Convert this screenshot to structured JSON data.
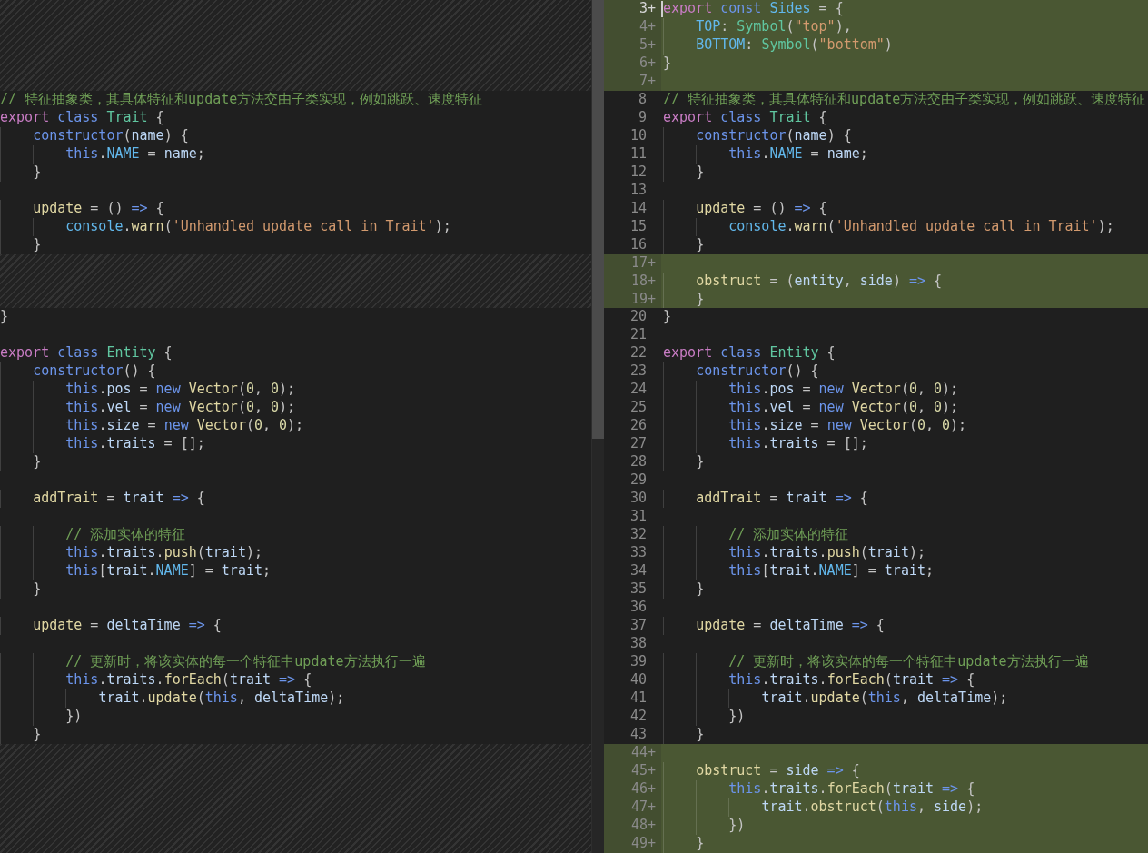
{
  "original_pane": {
    "lines": [
      {
        "kind": "filler"
      },
      {
        "kind": "filler"
      },
      {
        "kind": "filler"
      },
      {
        "kind": "filler"
      },
      {
        "kind": "filler"
      },
      {
        "kind": "code",
        "segments": [
          {
            "kind": "comment",
            "text": "// 特征抽象类，其具体特征和update方法交由子类实现，例如跳跃、速度特征"
          }
        ]
      },
      {
        "kind": "code",
        "segments": [
          {
            "kind": "keyword",
            "text": "export "
          },
          {
            "kind": "storage",
            "text": "class "
          },
          {
            "kind": "type",
            "text": "Trait"
          },
          {
            "kind": "plain",
            "text": " {"
          }
        ]
      },
      {
        "kind": "code",
        "segments": [
          {
            "kind": "storage",
            "text": "    constructor"
          },
          {
            "kind": "plain",
            "text": "("
          },
          {
            "kind": "variable",
            "text": "name"
          },
          {
            "kind": "plain",
            "text": ") {"
          }
        ]
      },
      {
        "kind": "code",
        "segments": [
          {
            "kind": "storage",
            "text": "        this"
          },
          {
            "kind": "plain",
            "text": "."
          },
          {
            "kind": "constant",
            "text": "NAME"
          },
          {
            "kind": "plain",
            "text": " = "
          },
          {
            "kind": "variable",
            "text": "name"
          },
          {
            "kind": "plain",
            "text": ";"
          }
        ]
      },
      {
        "kind": "code",
        "segments": [
          {
            "kind": "plain",
            "text": "    }"
          }
        ]
      },
      {
        "kind": "code"
      },
      {
        "kind": "code",
        "segments": [
          {
            "kind": "method",
            "text": "    update"
          },
          {
            "kind": "plain",
            "text": " = () "
          },
          {
            "kind": "storage",
            "text": "=>"
          },
          {
            "kind": "plain",
            "text": " {"
          }
        ]
      },
      {
        "kind": "code",
        "segments": [
          {
            "kind": "constant",
            "text": "        console"
          },
          {
            "kind": "plain",
            "text": "."
          },
          {
            "kind": "method",
            "text": "warn"
          },
          {
            "kind": "plain",
            "text": "("
          },
          {
            "kind": "string",
            "text": "'Unhandled update call in Trait'"
          },
          {
            "kind": "plain",
            "text": ");"
          }
        ]
      },
      {
        "kind": "code",
        "segments": [
          {
            "kind": "plain",
            "text": "    }"
          }
        ]
      },
      {
        "kind": "filler"
      },
      {
        "kind": "filler"
      },
      {
        "kind": "filler"
      },
      {
        "kind": "code",
        "segments": [
          {
            "kind": "plain",
            "text": "}"
          }
        ]
      },
      {
        "kind": "code"
      },
      {
        "kind": "code",
        "segments": [
          {
            "kind": "keyword",
            "text": "export "
          },
          {
            "kind": "storage",
            "text": "class "
          },
          {
            "kind": "type",
            "text": "Entity"
          },
          {
            "kind": "plain",
            "text": " {"
          }
        ]
      },
      {
        "kind": "code",
        "segments": [
          {
            "kind": "storage",
            "text": "    constructor"
          },
          {
            "kind": "plain",
            "text": "() {"
          }
        ]
      },
      {
        "kind": "code",
        "segments": [
          {
            "kind": "storage",
            "text": "        this"
          },
          {
            "kind": "plain",
            "text": "."
          },
          {
            "kind": "variable",
            "text": "pos"
          },
          {
            "kind": "plain",
            "text": " = "
          },
          {
            "kind": "storage",
            "text": "new "
          },
          {
            "kind": "method",
            "text": "Vector"
          },
          {
            "kind": "plain",
            "text": "("
          },
          {
            "kind": "number",
            "text": "0"
          },
          {
            "kind": "plain",
            "text": ", "
          },
          {
            "kind": "number",
            "text": "0"
          },
          {
            "kind": "plain",
            "text": ");"
          }
        ]
      },
      {
        "kind": "code",
        "segments": [
          {
            "kind": "storage",
            "text": "        this"
          },
          {
            "kind": "plain",
            "text": "."
          },
          {
            "kind": "variable",
            "text": "vel"
          },
          {
            "kind": "plain",
            "text": " = "
          },
          {
            "kind": "storage",
            "text": "new "
          },
          {
            "kind": "method",
            "text": "Vector"
          },
          {
            "kind": "plain",
            "text": "("
          },
          {
            "kind": "number",
            "text": "0"
          },
          {
            "kind": "plain",
            "text": ", "
          },
          {
            "kind": "number",
            "text": "0"
          },
          {
            "kind": "plain",
            "text": ");"
          }
        ]
      },
      {
        "kind": "code",
        "segments": [
          {
            "kind": "storage",
            "text": "        this"
          },
          {
            "kind": "plain",
            "text": "."
          },
          {
            "kind": "variable",
            "text": "size"
          },
          {
            "kind": "plain",
            "text": " = "
          },
          {
            "kind": "storage",
            "text": "new "
          },
          {
            "kind": "method",
            "text": "Vector"
          },
          {
            "kind": "plain",
            "text": "("
          },
          {
            "kind": "number",
            "text": "0"
          },
          {
            "kind": "plain",
            "text": ", "
          },
          {
            "kind": "number",
            "text": "0"
          },
          {
            "kind": "plain",
            "text": ");"
          }
        ]
      },
      {
        "kind": "code",
        "segments": [
          {
            "kind": "storage",
            "text": "        this"
          },
          {
            "kind": "plain",
            "text": "."
          },
          {
            "kind": "variable",
            "text": "traits"
          },
          {
            "kind": "plain",
            "text": " = [];"
          }
        ]
      },
      {
        "kind": "code",
        "segments": [
          {
            "kind": "plain",
            "text": "    }"
          }
        ]
      },
      {
        "kind": "code"
      },
      {
        "kind": "code",
        "segments": [
          {
            "kind": "method",
            "text": "    addTrait"
          },
          {
            "kind": "plain",
            "text": " = "
          },
          {
            "kind": "variable",
            "text": "trait"
          },
          {
            "kind": "storage",
            "text": " =>"
          },
          {
            "kind": "plain",
            "text": " {"
          }
        ]
      },
      {
        "kind": "code"
      },
      {
        "kind": "code",
        "segments": [
          {
            "kind": "comment",
            "text": "        // 添加实体的特征"
          }
        ]
      },
      {
        "kind": "code",
        "segments": [
          {
            "kind": "storage",
            "text": "        this"
          },
          {
            "kind": "plain",
            "text": "."
          },
          {
            "kind": "variable",
            "text": "traits"
          },
          {
            "kind": "plain",
            "text": "."
          },
          {
            "kind": "method",
            "text": "push"
          },
          {
            "kind": "plain",
            "text": "("
          },
          {
            "kind": "variable",
            "text": "trait"
          },
          {
            "kind": "plain",
            "text": ");"
          }
        ]
      },
      {
        "kind": "code",
        "segments": [
          {
            "kind": "storage",
            "text": "        this"
          },
          {
            "kind": "plain",
            "text": "["
          },
          {
            "kind": "variable",
            "text": "trait"
          },
          {
            "kind": "plain",
            "text": "."
          },
          {
            "kind": "constant",
            "text": "NAME"
          },
          {
            "kind": "plain",
            "text": "] = "
          },
          {
            "kind": "variable",
            "text": "trait"
          },
          {
            "kind": "plain",
            "text": ";"
          }
        ]
      },
      {
        "kind": "code",
        "segments": [
          {
            "kind": "plain",
            "text": "    }"
          }
        ]
      },
      {
        "kind": "code"
      },
      {
        "kind": "code",
        "segments": [
          {
            "kind": "method",
            "text": "    update"
          },
          {
            "kind": "plain",
            "text": " = "
          },
          {
            "kind": "variable",
            "text": "deltaTime"
          },
          {
            "kind": "storage",
            "text": " =>"
          },
          {
            "kind": "plain",
            "text": " {"
          }
        ]
      },
      {
        "kind": "code"
      },
      {
        "kind": "code",
        "segments": [
          {
            "kind": "comment",
            "text": "        // 更新时，将该实体的每一个特征中update方法执行一遍"
          }
        ]
      },
      {
        "kind": "code",
        "segments": [
          {
            "kind": "storage",
            "text": "        this"
          },
          {
            "kind": "plain",
            "text": "."
          },
          {
            "kind": "variable",
            "text": "traits"
          },
          {
            "kind": "plain",
            "text": "."
          },
          {
            "kind": "method",
            "text": "forEach"
          },
          {
            "kind": "plain",
            "text": "("
          },
          {
            "kind": "variable",
            "text": "trait"
          },
          {
            "kind": "storage",
            "text": " =>"
          },
          {
            "kind": "plain",
            "text": " {"
          }
        ]
      },
      {
        "kind": "code",
        "segments": [
          {
            "kind": "variable",
            "text": "            trait"
          },
          {
            "kind": "plain",
            "text": "."
          },
          {
            "kind": "method",
            "text": "update"
          },
          {
            "kind": "plain",
            "text": "("
          },
          {
            "kind": "storage",
            "text": "this"
          },
          {
            "kind": "plain",
            "text": ", "
          },
          {
            "kind": "variable",
            "text": "deltaTime"
          },
          {
            "kind": "plain",
            "text": ");"
          }
        ]
      },
      {
        "kind": "code",
        "segments": [
          {
            "kind": "plain",
            "text": "        })"
          }
        ]
      },
      {
        "kind": "code",
        "segments": [
          {
            "kind": "plain",
            "text": "    }"
          }
        ]
      },
      {
        "kind": "filler"
      },
      {
        "kind": "filler"
      },
      {
        "kind": "filler"
      },
      {
        "kind": "filler"
      },
      {
        "kind": "filler"
      },
      {
        "kind": "filler"
      }
    ]
  },
  "modified_pane": {
    "lines": [
      {
        "number": "3+",
        "added": true,
        "cursor": true,
        "segments": [
          {
            "kind": "keyword",
            "text": "export "
          },
          {
            "kind": "storage",
            "text": "const "
          },
          {
            "kind": "constant",
            "text": "Sides"
          },
          {
            "kind": "plain",
            "text": " = {"
          }
        ]
      },
      {
        "number": "4+",
        "added": true,
        "cursor": false,
        "segments": [
          {
            "kind": "constant",
            "text": "    TOP"
          },
          {
            "kind": "plain",
            "text": ": "
          },
          {
            "kind": "type",
            "text": "Symbol"
          },
          {
            "kind": "plain",
            "text": "("
          },
          {
            "kind": "string",
            "text": "\"top\""
          },
          {
            "kind": "plain",
            "text": "),"
          }
        ]
      },
      {
        "number": "5+",
        "added": true,
        "cursor": false,
        "segments": [
          {
            "kind": "constant",
            "text": "    BOTTOM"
          },
          {
            "kind": "plain",
            "text": ": "
          },
          {
            "kind": "type",
            "text": "Symbol"
          },
          {
            "kind": "plain",
            "text": "("
          },
          {
            "kind": "string",
            "text": "\"bottom\""
          },
          {
            "kind": "plain",
            "text": ")"
          }
        ]
      },
      {
        "number": "6+",
        "added": true,
        "cursor": false,
        "segments": [
          {
            "kind": "plain",
            "text": "}"
          }
        ]
      },
      {
        "number": "7+",
        "added": true,
        "cursor": false
      },
      {
        "number": "8",
        "added": false,
        "cursor": false,
        "segments": [
          {
            "kind": "comment",
            "text": "// 特征抽象类，其具体特征和update方法交由子类实现，例如跳跃、速度特征"
          }
        ]
      },
      {
        "number": "9",
        "added": false,
        "cursor": false,
        "segments": [
          {
            "kind": "keyword",
            "text": "export "
          },
          {
            "kind": "storage",
            "text": "class "
          },
          {
            "kind": "type",
            "text": "Trait"
          },
          {
            "kind": "plain",
            "text": " {"
          }
        ]
      },
      {
        "number": "10",
        "added": false,
        "cursor": false,
        "segments": [
          {
            "kind": "storage",
            "text": "    constructor"
          },
          {
            "kind": "plain",
            "text": "("
          },
          {
            "kind": "variable",
            "text": "name"
          },
          {
            "kind": "plain",
            "text": ") {"
          }
        ]
      },
      {
        "number": "11",
        "added": false,
        "cursor": false,
        "segments": [
          {
            "kind": "storage",
            "text": "        this"
          },
          {
            "kind": "plain",
            "text": "."
          },
          {
            "kind": "constant",
            "text": "NAME"
          },
          {
            "kind": "plain",
            "text": " = "
          },
          {
            "kind": "variable",
            "text": "name"
          },
          {
            "kind": "plain",
            "text": ";"
          }
        ]
      },
      {
        "number": "12",
        "added": false,
        "cursor": false,
        "segments": [
          {
            "kind": "plain",
            "text": "    }"
          }
        ]
      },
      {
        "number": "13",
        "added": false,
        "cursor": false
      },
      {
        "number": "14",
        "added": false,
        "cursor": false,
        "segments": [
          {
            "kind": "method",
            "text": "    update"
          },
          {
            "kind": "plain",
            "text": " = () "
          },
          {
            "kind": "storage",
            "text": "=>"
          },
          {
            "kind": "plain",
            "text": " {"
          }
        ]
      },
      {
        "number": "15",
        "added": false,
        "cursor": false,
        "segments": [
          {
            "kind": "constant",
            "text": "        console"
          },
          {
            "kind": "plain",
            "text": "."
          },
          {
            "kind": "method",
            "text": "warn"
          },
          {
            "kind": "plain",
            "text": "("
          },
          {
            "kind": "string",
            "text": "'Unhandled update call in Trait'"
          },
          {
            "kind": "plain",
            "text": ");"
          }
        ]
      },
      {
        "number": "16",
        "added": false,
        "cursor": false,
        "segments": [
          {
            "kind": "plain",
            "text": "    }"
          }
        ]
      },
      {
        "number": "17+",
        "added": true,
        "cursor": false
      },
      {
        "number": "18+",
        "added": true,
        "cursor": false,
        "segments": [
          {
            "kind": "method",
            "text": "    obstruct"
          },
          {
            "kind": "plain",
            "text": " = ("
          },
          {
            "kind": "variable",
            "text": "entity"
          },
          {
            "kind": "plain",
            "text": ", "
          },
          {
            "kind": "variable",
            "text": "side"
          },
          {
            "kind": "plain",
            "text": ") "
          },
          {
            "kind": "storage",
            "text": "=>"
          },
          {
            "kind": "plain",
            "text": " {"
          }
        ]
      },
      {
        "number": "19+",
        "added": true,
        "cursor": false,
        "segments": [
          {
            "kind": "plain",
            "text": "    }"
          }
        ]
      },
      {
        "number": "20",
        "added": false,
        "cursor": false,
        "segments": [
          {
            "kind": "plain",
            "text": "}"
          }
        ]
      },
      {
        "number": "21",
        "added": false,
        "cursor": false
      },
      {
        "number": "22",
        "added": false,
        "cursor": false,
        "segments": [
          {
            "kind": "keyword",
            "text": "export "
          },
          {
            "kind": "storage",
            "text": "class "
          },
          {
            "kind": "type",
            "text": "Entity"
          },
          {
            "kind": "plain",
            "text": " {"
          }
        ]
      },
      {
        "number": "23",
        "added": false,
        "cursor": false,
        "segments": [
          {
            "kind": "storage",
            "text": "    constructor"
          },
          {
            "kind": "plain",
            "text": "() {"
          }
        ]
      },
      {
        "number": "24",
        "added": false,
        "cursor": false,
        "segments": [
          {
            "kind": "storage",
            "text": "        this"
          },
          {
            "kind": "plain",
            "text": "."
          },
          {
            "kind": "variable",
            "text": "pos"
          },
          {
            "kind": "plain",
            "text": " = "
          },
          {
            "kind": "storage",
            "text": "new "
          },
          {
            "kind": "method",
            "text": "Vector"
          },
          {
            "kind": "plain",
            "text": "("
          },
          {
            "kind": "number",
            "text": "0"
          },
          {
            "kind": "plain",
            "text": ", "
          },
          {
            "kind": "number",
            "text": "0"
          },
          {
            "kind": "plain",
            "text": ");"
          }
        ]
      },
      {
        "number": "25",
        "added": false,
        "cursor": false,
        "segments": [
          {
            "kind": "storage",
            "text": "        this"
          },
          {
            "kind": "plain",
            "text": "."
          },
          {
            "kind": "variable",
            "text": "vel"
          },
          {
            "kind": "plain",
            "text": " = "
          },
          {
            "kind": "storage",
            "text": "new "
          },
          {
            "kind": "method",
            "text": "Vector"
          },
          {
            "kind": "plain",
            "text": "("
          },
          {
            "kind": "number",
            "text": "0"
          },
          {
            "kind": "plain",
            "text": ", "
          },
          {
            "kind": "number",
            "text": "0"
          },
          {
            "kind": "plain",
            "text": ");"
          }
        ]
      },
      {
        "number": "26",
        "added": false,
        "cursor": false,
        "segments": [
          {
            "kind": "storage",
            "text": "        this"
          },
          {
            "kind": "plain",
            "text": "."
          },
          {
            "kind": "variable",
            "text": "size"
          },
          {
            "kind": "plain",
            "text": " = "
          },
          {
            "kind": "storage",
            "text": "new "
          },
          {
            "kind": "method",
            "text": "Vector"
          },
          {
            "kind": "plain",
            "text": "("
          },
          {
            "kind": "number",
            "text": "0"
          },
          {
            "kind": "plain",
            "text": ", "
          },
          {
            "kind": "number",
            "text": "0"
          },
          {
            "kind": "plain",
            "text": ");"
          }
        ]
      },
      {
        "number": "27",
        "added": false,
        "cursor": false,
        "segments": [
          {
            "kind": "storage",
            "text": "        this"
          },
          {
            "kind": "plain",
            "text": "."
          },
          {
            "kind": "variable",
            "text": "traits"
          },
          {
            "kind": "plain",
            "text": " = [];"
          }
        ]
      },
      {
        "number": "28",
        "added": false,
        "cursor": false,
        "segments": [
          {
            "kind": "plain",
            "text": "    }"
          }
        ]
      },
      {
        "number": "29",
        "added": false,
        "cursor": false
      },
      {
        "number": "30",
        "added": false,
        "cursor": false,
        "segments": [
          {
            "kind": "method",
            "text": "    addTrait"
          },
          {
            "kind": "plain",
            "text": " = "
          },
          {
            "kind": "variable",
            "text": "trait"
          },
          {
            "kind": "storage",
            "text": " =>"
          },
          {
            "kind": "plain",
            "text": " {"
          }
        ]
      },
      {
        "number": "31",
        "added": false,
        "cursor": false
      },
      {
        "number": "32",
        "added": false,
        "cursor": false,
        "segments": [
          {
            "kind": "comment",
            "text": "        // 添加实体的特征"
          }
        ]
      },
      {
        "number": "33",
        "added": false,
        "cursor": false,
        "segments": [
          {
            "kind": "storage",
            "text": "        this"
          },
          {
            "kind": "plain",
            "text": "."
          },
          {
            "kind": "variable",
            "text": "traits"
          },
          {
            "kind": "plain",
            "text": "."
          },
          {
            "kind": "method",
            "text": "push"
          },
          {
            "kind": "plain",
            "text": "("
          },
          {
            "kind": "variable",
            "text": "trait"
          },
          {
            "kind": "plain",
            "text": ");"
          }
        ]
      },
      {
        "number": "34",
        "added": false,
        "cursor": false,
        "segments": [
          {
            "kind": "storage",
            "text": "        this"
          },
          {
            "kind": "plain",
            "text": "["
          },
          {
            "kind": "variable",
            "text": "trait"
          },
          {
            "kind": "plain",
            "text": "."
          },
          {
            "kind": "constant",
            "text": "NAME"
          },
          {
            "kind": "plain",
            "text": "] = "
          },
          {
            "kind": "variable",
            "text": "trait"
          },
          {
            "kind": "plain",
            "text": ";"
          }
        ]
      },
      {
        "number": "35",
        "added": false,
        "cursor": false,
        "segments": [
          {
            "kind": "plain",
            "text": "    }"
          }
        ]
      },
      {
        "number": "36",
        "added": false,
        "cursor": false
      },
      {
        "number": "37",
        "added": false,
        "cursor": false,
        "segments": [
          {
            "kind": "method",
            "text": "    update"
          },
          {
            "kind": "plain",
            "text": " = "
          },
          {
            "kind": "variable",
            "text": "deltaTime"
          },
          {
            "kind": "storage",
            "text": " =>"
          },
          {
            "kind": "plain",
            "text": " {"
          }
        ]
      },
      {
        "number": "38",
        "added": false,
        "cursor": false
      },
      {
        "number": "39",
        "added": false,
        "cursor": false,
        "segments": [
          {
            "kind": "comment",
            "text": "        // 更新时，将该实体的每一个特征中update方法执行一遍"
          }
        ]
      },
      {
        "number": "40",
        "added": false,
        "cursor": false,
        "segments": [
          {
            "kind": "storage",
            "text": "        this"
          },
          {
            "kind": "plain",
            "text": "."
          },
          {
            "kind": "variable",
            "text": "traits"
          },
          {
            "kind": "plain",
            "text": "."
          },
          {
            "kind": "method",
            "text": "forEach"
          },
          {
            "kind": "plain",
            "text": "("
          },
          {
            "kind": "variable",
            "text": "trait"
          },
          {
            "kind": "storage",
            "text": " =>"
          },
          {
            "kind": "plain",
            "text": " {"
          }
        ]
      },
      {
        "number": "41",
        "added": false,
        "cursor": false,
        "segments": [
          {
            "kind": "variable",
            "text": "            trait"
          },
          {
            "kind": "plain",
            "text": "."
          },
          {
            "kind": "method",
            "text": "update"
          },
          {
            "kind": "plain",
            "text": "("
          },
          {
            "kind": "storage",
            "text": "this"
          },
          {
            "kind": "plain",
            "text": ", "
          },
          {
            "kind": "variable",
            "text": "deltaTime"
          },
          {
            "kind": "plain",
            "text": ");"
          }
        ]
      },
      {
        "number": "42",
        "added": false,
        "cursor": false,
        "segments": [
          {
            "kind": "plain",
            "text": "        })"
          }
        ]
      },
      {
        "number": "43",
        "added": false,
        "cursor": false,
        "segments": [
          {
            "kind": "plain",
            "text": "    }"
          }
        ]
      },
      {
        "number": "44+",
        "added": true,
        "cursor": false
      },
      {
        "number": "45+",
        "added": true,
        "cursor": false,
        "segments": [
          {
            "kind": "method",
            "text": "    obstruct"
          },
          {
            "kind": "plain",
            "text": " = "
          },
          {
            "kind": "variable",
            "text": "side"
          },
          {
            "kind": "storage",
            "text": " =>"
          },
          {
            "kind": "plain",
            "text": " {"
          }
        ]
      },
      {
        "number": "46+",
        "added": true,
        "cursor": false,
        "segments": [
          {
            "kind": "storage",
            "text": "        this"
          },
          {
            "kind": "plain",
            "text": "."
          },
          {
            "kind": "variable",
            "text": "traits"
          },
          {
            "kind": "plain",
            "text": "."
          },
          {
            "kind": "method",
            "text": "forEach"
          },
          {
            "kind": "plain",
            "text": "("
          },
          {
            "kind": "variable",
            "text": "trait"
          },
          {
            "kind": "storage",
            "text": " =>"
          },
          {
            "kind": "plain",
            "text": " {"
          }
        ]
      },
      {
        "number": "47+",
        "added": true,
        "cursor": false,
        "segments": [
          {
            "kind": "variable",
            "text": "            trait"
          },
          {
            "kind": "plain",
            "text": "."
          },
          {
            "kind": "method",
            "text": "obstruct"
          },
          {
            "kind": "plain",
            "text": "("
          },
          {
            "kind": "storage",
            "text": "this"
          },
          {
            "kind": "plain",
            "text": ", "
          },
          {
            "kind": "variable",
            "text": "side"
          },
          {
            "kind": "plain",
            "text": ");"
          }
        ]
      },
      {
        "number": "48+",
        "added": true,
        "cursor": false,
        "segments": [
          {
            "kind": "plain",
            "text": "        })"
          }
        ]
      },
      {
        "number": "49+",
        "added": true,
        "cursor": false,
        "segments": [
          {
            "kind": "plain",
            "text": "    }"
          }
        ]
      }
    ]
  }
}
